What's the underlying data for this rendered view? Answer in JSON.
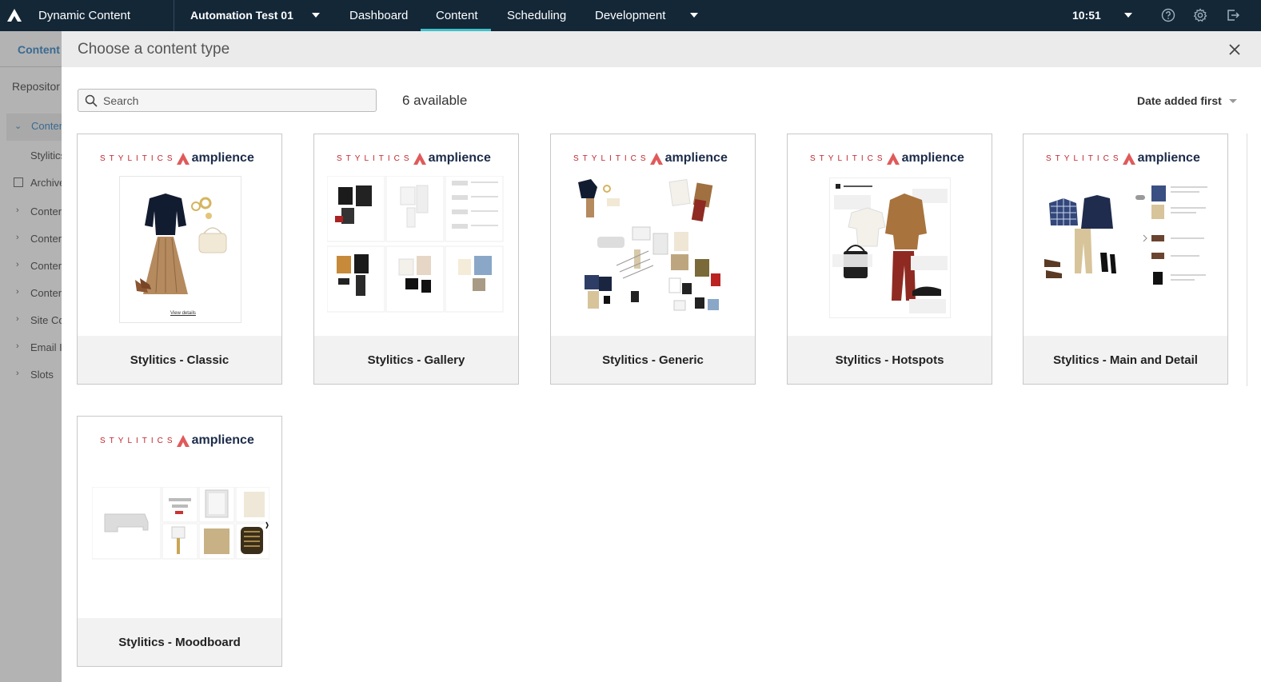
{
  "app": {
    "name": "Dynamic Content",
    "hub": "Automation Test 01",
    "clock": "10:51"
  },
  "nav": [
    {
      "label": "Dashboard"
    },
    {
      "label": "Content"
    },
    {
      "label": "Scheduling"
    },
    {
      "label": "Development"
    }
  ],
  "background": {
    "tab": "Content",
    "rows": [
      "Repositor",
      "Conten",
      "Stylitics",
      "Archive",
      "Conten",
      "Conten",
      "Conten",
      "Conten",
      "Site Co",
      "Email I",
      "Slots"
    ]
  },
  "modal": {
    "title": "Choose a content type",
    "search_placeholder": "Search",
    "count": "6 available",
    "sort": "Date added first",
    "brand_left": "STYLITICS",
    "brand_right": "amplience",
    "cards": [
      {
        "label": "Stylitics - Classic",
        "caption": "View details"
      },
      {
        "label": "Stylitics - Gallery"
      },
      {
        "label": "Stylitics - Generic"
      },
      {
        "label": "Stylitics - Hotspots"
      },
      {
        "label": "Stylitics - Main and Detail"
      },
      {
        "label": "Stylitics - Moodboard"
      }
    ]
  },
  "colors": {
    "topbar": "#132737",
    "accent": "#3fc1c9",
    "brand_red": "#c0262d",
    "brand_navy": "#1c2c4a"
  }
}
